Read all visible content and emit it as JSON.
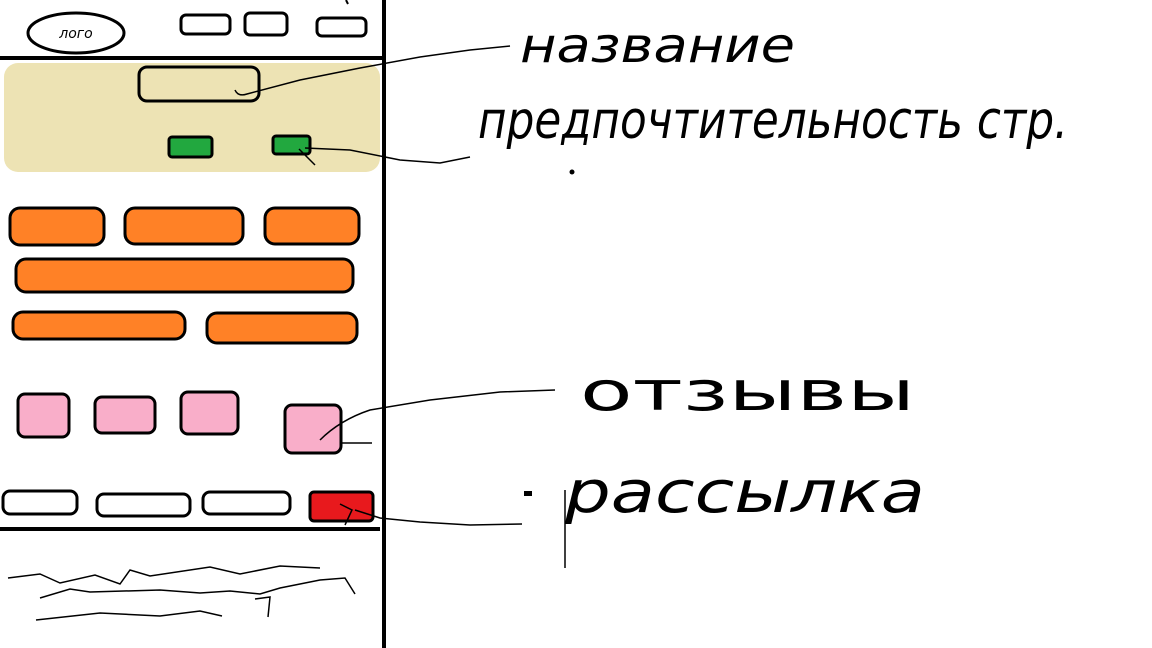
{
  "mockup": {
    "logo_text": "лого",
    "colors": {
      "hero_bg": "#ede3b4",
      "green": "#22a83f",
      "orange": "#ff8126",
      "pink": "#f9aec9",
      "red": "#e8191d",
      "stroke": "#000000"
    },
    "header_buttons": 3,
    "hero_buttons": 2,
    "orange_blocks": 6,
    "pink_tiles": 4,
    "bottom_bar_buttons": 4
  },
  "annotations": {
    "title_note": "название",
    "buttons_note": "предпочтительность стр.",
    "reviews_note": "отзывы",
    "mailing_note": "рассылка"
  }
}
